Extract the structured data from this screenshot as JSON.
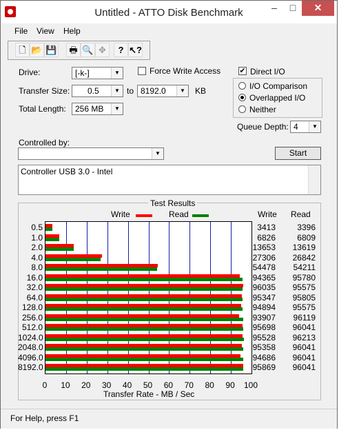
{
  "window": {
    "title": "Untitled - ATTO Disk Benchmark",
    "min": "–",
    "max": "□",
    "close": "✕"
  },
  "menu": [
    "File",
    "View",
    "Help"
  ],
  "toolbar": [
    {
      "name": "new-icon",
      "glyph": "🗋"
    },
    {
      "name": "open-icon",
      "glyph": "📂"
    },
    {
      "name": "save-icon",
      "glyph": "💾"
    },
    {
      "name": "print-icon",
      "glyph": "🖶"
    },
    {
      "name": "print-preview-icon",
      "glyph": "🔍"
    },
    {
      "name": "move-icon",
      "glyph": "✥"
    },
    {
      "name": "help-icon",
      "glyph": "?"
    },
    {
      "name": "context-help-icon",
      "glyph": "↖?"
    }
  ],
  "form": {
    "drive_label": "Drive:",
    "drive_value": "[-k-]",
    "force_write_access": "Force Write Access",
    "direct_io": "Direct I/O",
    "transfer_size_label": "Transfer Size:",
    "transfer_from": "0.5",
    "to_label": "to",
    "transfer_to": "8192.0",
    "kb_label": "KB",
    "total_length_label": "Total Length:",
    "total_length_value": "256 MB",
    "io_comparison": "I/O Comparison",
    "overlapped_io": "Overlapped I/O",
    "neither": "Neither",
    "queue_depth_label": "Queue Depth:",
    "queue_depth_value": "4",
    "controlled_by_label": "Controlled by:",
    "controlled_by_value": "",
    "start_button": "Start",
    "description": "Controller USB 3.0 - Intel"
  },
  "results": {
    "title": "Test Results",
    "legend_write": "Write",
    "legend_read": "Read",
    "col_write": "Write",
    "col_read": "Read",
    "x_title": "Transfer Rate - MB / Sec"
  },
  "chart_data": {
    "type": "bar",
    "orientation": "horizontal",
    "categories": [
      "0.5",
      "1.0",
      "2.0",
      "4.0",
      "8.0",
      "16.0",
      "32.0",
      "64.0",
      "128.0",
      "256.0",
      "512.0",
      "1024.0",
      "2048.0",
      "4096.0",
      "8192.0"
    ],
    "series": [
      {
        "name": "Write",
        "color": "#ff0000",
        "values": [
          3413,
          6826,
          13653,
          27306,
          54478,
          94365,
          96035,
          95347,
          94894,
          93907,
          95698,
          95528,
          95358,
          94686,
          95869
        ]
      },
      {
        "name": "Read",
        "color": "#008000",
        "values": [
          3396,
          6809,
          13619,
          26842,
          54211,
          95780,
          95575,
          95805,
          95575,
          96119,
          96041,
          96213,
          96041,
          96041,
          96041
        ]
      }
    ],
    "x_ticks": [
      "0",
      "10",
      "20",
      "30",
      "40",
      "50",
      "60",
      "70",
      "80",
      "90",
      "100"
    ],
    "xlim": [
      0,
      100
    ],
    "xlabel": "Transfer Rate - MB / Sec",
    "legend": "top"
  },
  "status": "For Help, press F1"
}
